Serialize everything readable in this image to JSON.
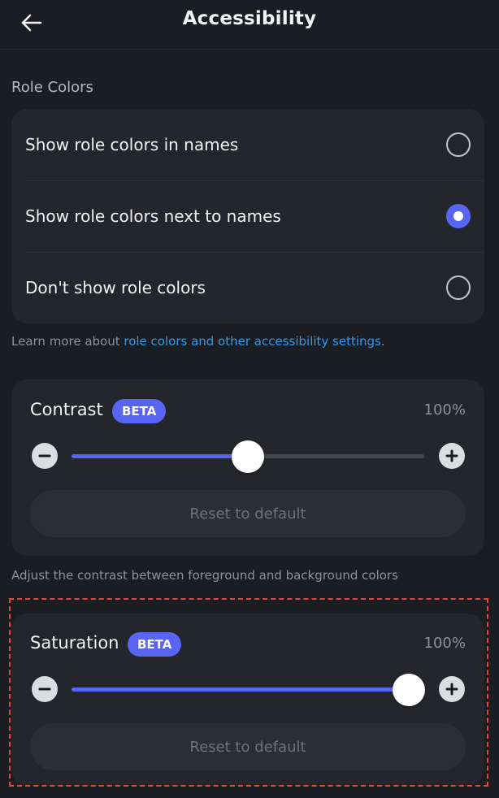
{
  "header": {
    "title": "Accessibility",
    "back_icon": "arrow-left-icon"
  },
  "role_colors": {
    "section_label": "Role Colors",
    "options": [
      {
        "label": "Show role colors in names",
        "selected": false
      },
      {
        "label": "Show role colors next to names",
        "selected": true
      },
      {
        "label": "Don't show role colors",
        "selected": false
      }
    ],
    "help_prefix": "Learn more about ",
    "help_link": "role colors and other accessibility settings",
    "help_suffix": "."
  },
  "contrast": {
    "title": "Contrast",
    "badge": "BETA",
    "value_text": "100%",
    "level": 0.5,
    "reset_label": "Reset to default",
    "help_text": "Adjust the contrast between foreground and background colors"
  },
  "saturation": {
    "title": "Saturation",
    "badge": "BETA",
    "value_text": "100%",
    "level": 1.0,
    "reset_label": "Reset to default"
  },
  "colors": {
    "accent": "#5865f2",
    "link": "#2f9bf0",
    "background": "#1c1d22",
    "card": "#25262c",
    "highlight": "#e0483a"
  }
}
